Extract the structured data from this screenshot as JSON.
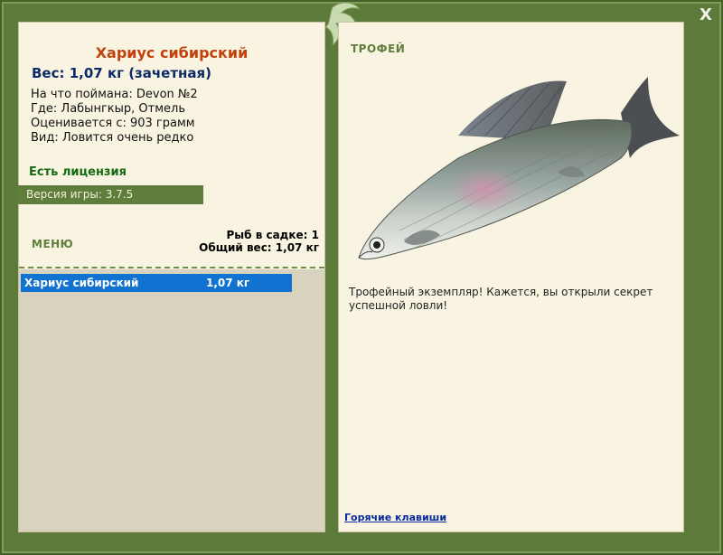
{
  "window": {
    "close_label": "X"
  },
  "left": {
    "fish_name": "Хариус сибирский",
    "weight_line": "Вес: 1,07 кг (зачетная)",
    "caught_on": "На что поймана: Devon №2",
    "where": "Где: Лабынгкыр, Отмель",
    "valued_from": "Оценивается с: 903 грамм",
    "kind": "Вид: Ловится очень редко",
    "license": "Есть лицензия",
    "version": "Версия игры: 3.7.5",
    "menu_label": "МЕНЮ",
    "stats": {
      "fish_in_keepnet": "Рыб в садке: 1",
      "total_weight": "Общий вес: 1,07 кг"
    },
    "list": [
      {
        "name": "Хариус сибирский",
        "weight": "1,07 кг"
      }
    ]
  },
  "right": {
    "trophy_label": "ТРОФЕЙ",
    "trophy_text": "Трофейный экземпляр! Кажется, вы открыли секрет успешной ловли!",
    "hotkeys": "Горячие клавиши"
  },
  "colors": {
    "frame_green": "#5c7a3a",
    "panel_bg": "#f8f4e1",
    "selection_blue": "#1173d1",
    "title_orange": "#c2410c",
    "weight_blue": "#0b2a66"
  },
  "icons": {
    "logo": "fish-logo-icon",
    "close": "close-icon"
  }
}
